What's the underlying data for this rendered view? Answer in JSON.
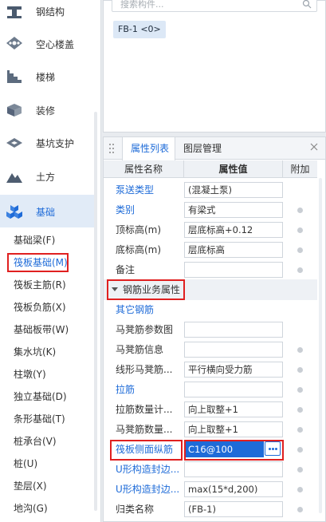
{
  "categories": [
    {
      "label": "钢结构",
      "icon": "steel-structure-icon"
    },
    {
      "label": "空心楼盖",
      "icon": "hollow-floor-icon"
    },
    {
      "label": "楼梯",
      "icon": "stairs-icon"
    },
    {
      "label": "装修",
      "icon": "decoration-icon"
    },
    {
      "label": "基坑支护",
      "icon": "pit-support-icon"
    },
    {
      "label": "土方",
      "icon": "earthwork-icon"
    },
    {
      "label": "基础",
      "icon": "foundation-icon",
      "active": true
    }
  ],
  "subitems": [
    "基础梁(F)",
    "筏板基础(M)",
    "筏板主筋(R)",
    "筏板负筋(X)",
    "基础板带(W)",
    "集水坑(K)",
    "柱墩(Y)",
    "独立基础(D)",
    "条形基础(T)",
    "桩承台(V)",
    "桩(U)",
    "垫层(X)",
    "地沟(G)"
  ],
  "component_panel": {
    "search_placeholder": "搜索构件...",
    "item": "FB-1 <0>"
  },
  "property_panel": {
    "tabs": [
      "属性列表",
      "图层管理"
    ],
    "headers": [
      "属性名称",
      "属性值",
      "附加"
    ],
    "rows_top": [
      {
        "name": "泵送类型",
        "value": "(混凝土泵)",
        "link": true,
        "dot": false
      },
      {
        "name": "类别",
        "value": "有梁式",
        "link": true,
        "dot": true
      },
      {
        "name": "顶标高(m)",
        "value": "层底标高+0.12",
        "link": false,
        "dot": true
      },
      {
        "name": "底标高(m)",
        "value": "层底标高",
        "link": false,
        "dot": true
      },
      {
        "name": "备注",
        "value": "",
        "link": false,
        "dot": true
      }
    ],
    "group_label": "钢筋业务属性",
    "rows_bottom": [
      {
        "name": "其它钢筋",
        "value": "",
        "link": true,
        "dot": false
      },
      {
        "name": "马凳筋参数图",
        "value": "",
        "link": false,
        "dot": false
      },
      {
        "name": "马凳筋信息",
        "value": "",
        "link": false,
        "dot": true
      },
      {
        "name": "线形马凳筋...",
        "value": "平行横向受力筋",
        "link": false,
        "dot": true
      },
      {
        "name": "拉筋",
        "value": "",
        "link": true,
        "dot": true
      },
      {
        "name": "拉筋数量计...",
        "value": "向上取整+1",
        "link": false,
        "dot": true
      },
      {
        "name": "马凳筋数量...",
        "value": "向上取整+1",
        "link": false,
        "dot": true
      },
      {
        "name": "筏板侧面纵筋",
        "value": "C16@100",
        "link": true,
        "dot": true,
        "editing": true
      },
      {
        "name": "U形构造封边...",
        "value": "",
        "link": true,
        "dot": true
      },
      {
        "name": "U形构造封边...",
        "value": "max(15*d,200)",
        "link": true,
        "dot": true
      },
      {
        "name": "归类名称",
        "value": "(FB-1)",
        "link": false,
        "dot": true
      }
    ]
  },
  "colors": {
    "accent": "#1e6bd8",
    "highlight_box": "#e02020",
    "active_bg": "#e1ebf7"
  }
}
